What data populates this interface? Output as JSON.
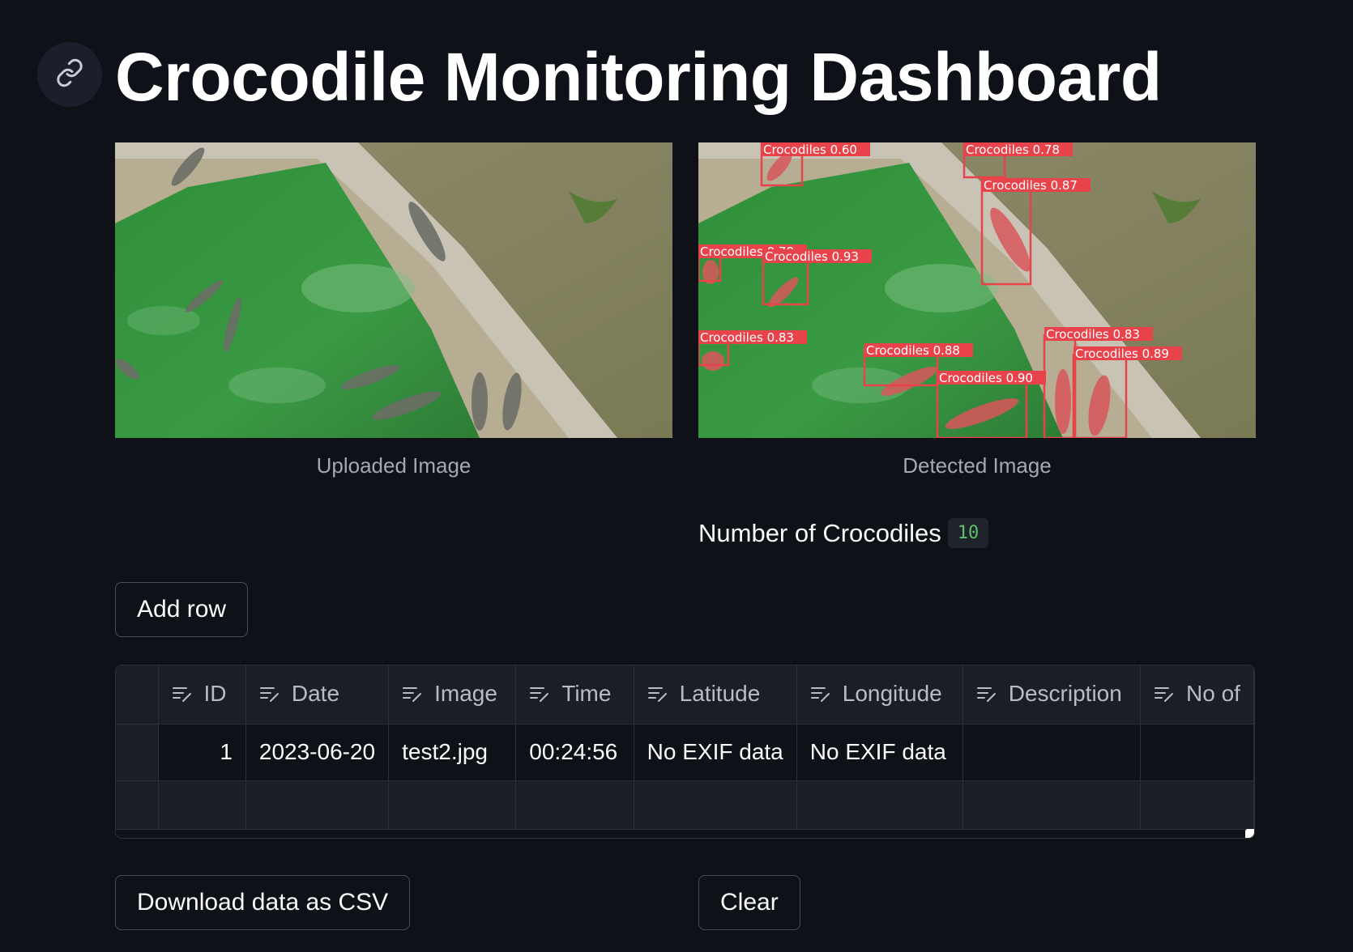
{
  "page": {
    "title": "Crocodile Monitoring Dashboard"
  },
  "icons": {
    "anchor": "link-icon",
    "column_type": "edit-text-icon"
  },
  "images": {
    "uploaded": {
      "caption": "Uploaded Image"
    },
    "detected": {
      "caption": "Detected Image",
      "label_color": "#e8434b",
      "detections": [
        {
          "label": "Crocodiles 0.60"
        },
        {
          "label": "Crocodiles 0.78"
        },
        {
          "label": "Crocodiles 0.87"
        },
        {
          "label": "Crocodiles 0.78"
        },
        {
          "label": "Crocodiles 0.93"
        },
        {
          "label": "Crocodiles 0.83"
        },
        {
          "label": "Crocodiles 0.88"
        },
        {
          "label": "Crocodiles 0.90"
        },
        {
          "label": "Crocodiles 0.83"
        },
        {
          "label": "Crocodiles 0.89"
        }
      ]
    }
  },
  "metric": {
    "label": "Number of Crocodiles",
    "value": "10",
    "value_color": "#5fbf6a"
  },
  "buttons": {
    "add_row": "Add row",
    "download_csv": "Download data as CSV",
    "clear": "Clear"
  },
  "table": {
    "columns": [
      "ID",
      "Date",
      "Image",
      "Time",
      "Latitude",
      "Longitude",
      "Description",
      "No of"
    ],
    "rows": [
      [
        "1",
        "2023-06-20",
        "test2.jpg",
        "00:24:56",
        "No EXIF data",
        "No EXIF data",
        "",
        ""
      ]
    ]
  }
}
